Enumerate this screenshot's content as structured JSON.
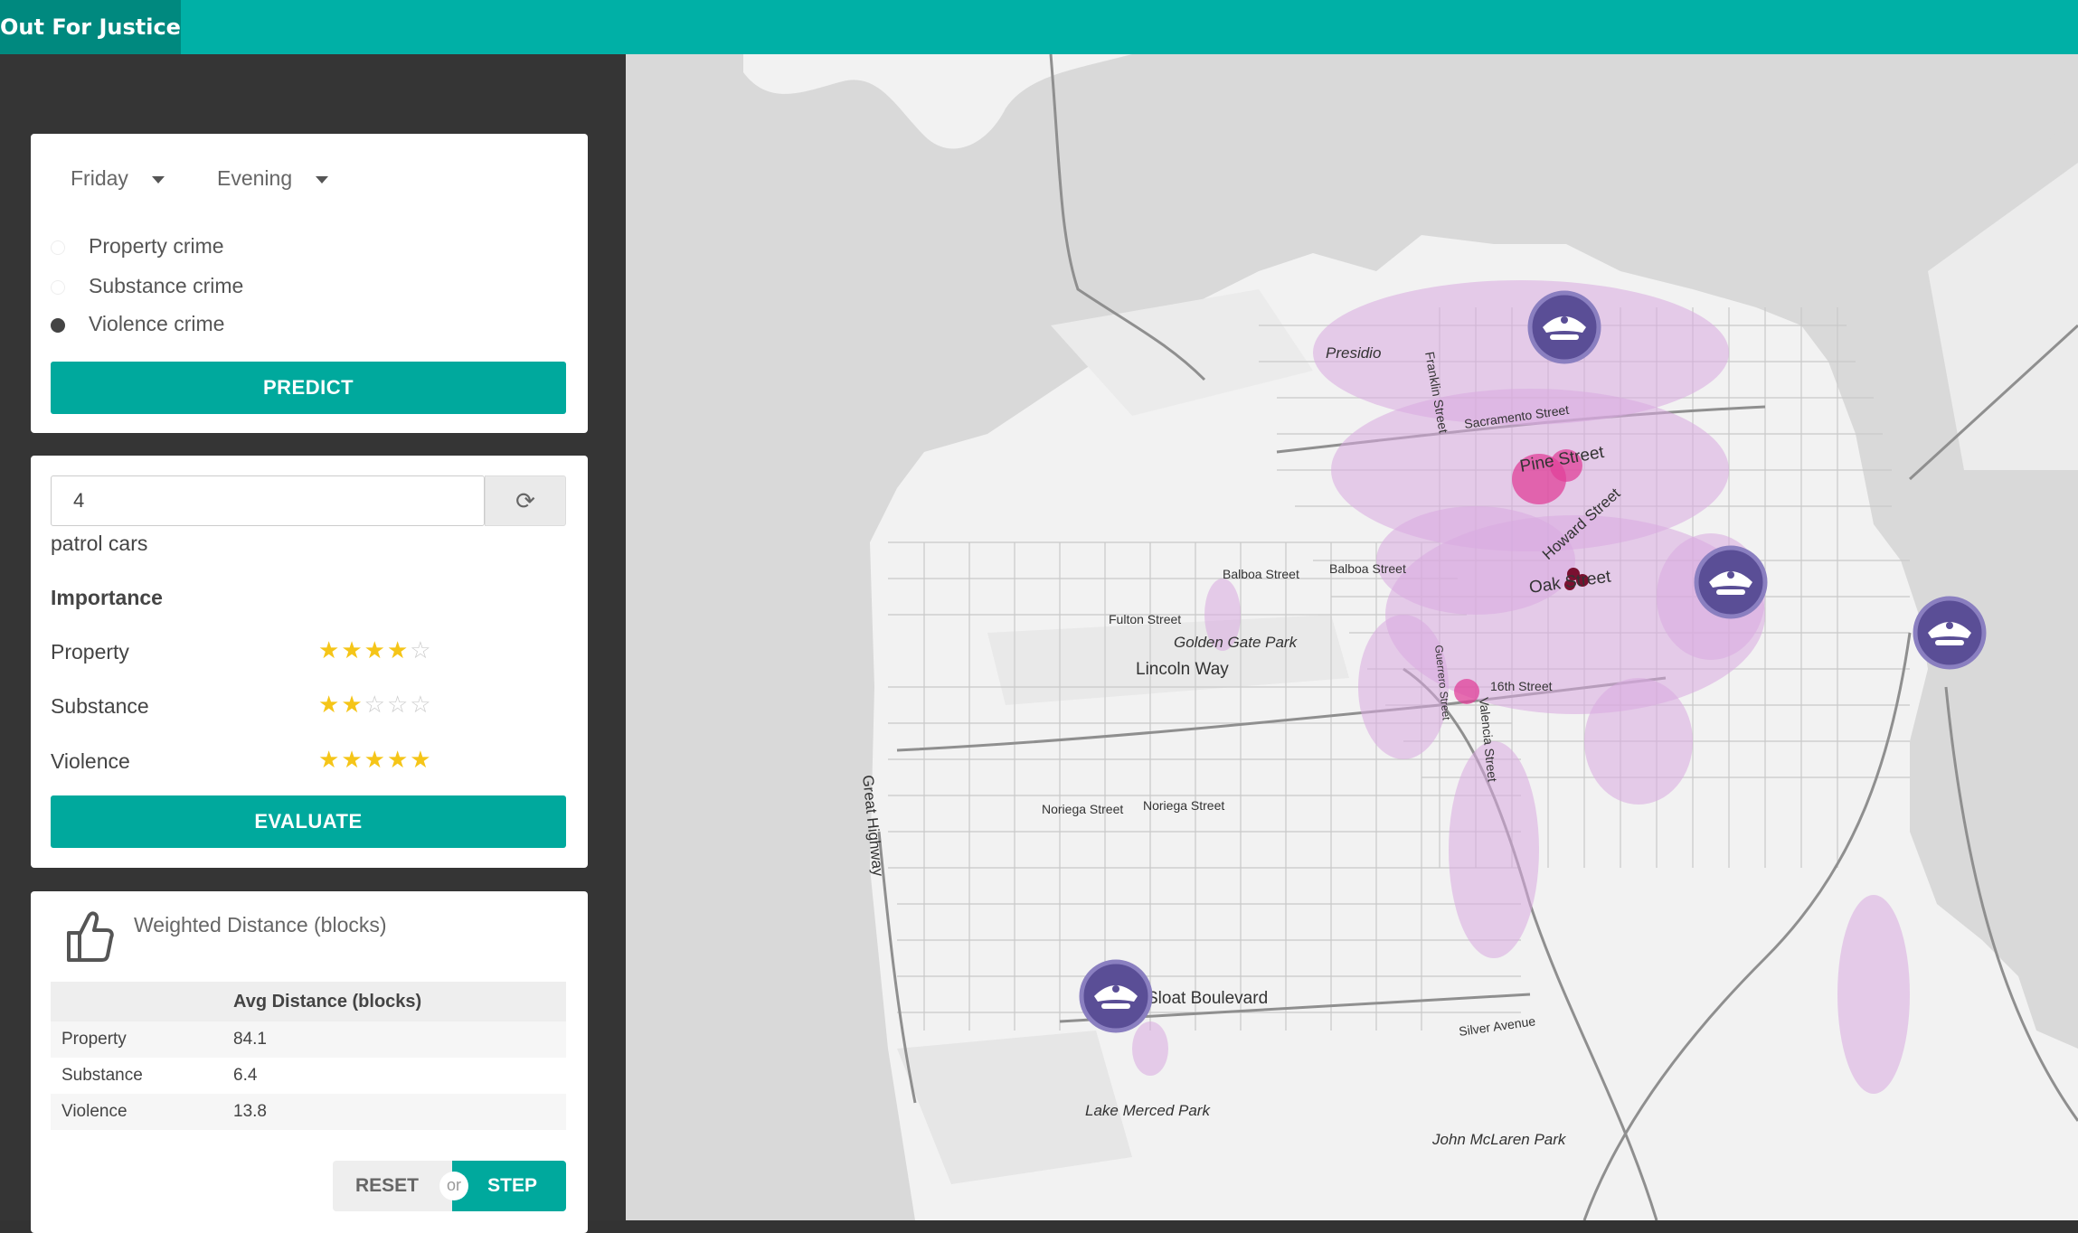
{
  "app": {
    "title": "Out For Justice"
  },
  "filters": {
    "day": "Friday",
    "time": "Evening",
    "crime_types": [
      {
        "label": "Property crime",
        "selected": false
      },
      {
        "label": "Substance crime",
        "selected": false
      },
      {
        "label": "Violence crime",
        "selected": true
      }
    ],
    "predict_label": "PREDICT"
  },
  "patrol": {
    "cars_value": "4",
    "cars_label": "patrol cars",
    "refresh_icon": "refresh-icon",
    "importance_title": "Importance",
    "importance": [
      {
        "label": "Property",
        "stars": 4,
        "max": 5
      },
      {
        "label": "Substance",
        "stars": 2,
        "max": 5
      },
      {
        "label": "Violence",
        "stars": 5,
        "max": 5
      }
    ],
    "evaluate_label": "EVALUATE"
  },
  "results": {
    "icon": "thumbs-up-icon",
    "title": "Weighted Distance (blocks)",
    "table_header": [
      "",
      "Avg Distance (blocks)"
    ],
    "rows": [
      {
        "type": "Property",
        "value": "84.1"
      },
      {
        "type": "Substance",
        "value": "6.4"
      },
      {
        "type": "Violence",
        "value": "13.8"
      }
    ],
    "reset_label": "RESET",
    "or_label": "or",
    "step_label": "STEP"
  },
  "map": {
    "street_labels": [
      "Presidio",
      "Franklin Street",
      "Sacramento Street",
      "Pine Street",
      "Howard Street",
      "Oak Street",
      "Balboa Street",
      "Balboa Street",
      "Fulton Street",
      "Golden Gate Park",
      "Lincoln Way",
      "Guerrero Street",
      "Valencia Street",
      "16th Street",
      "Great Highway",
      "Noriega Street",
      "Noriega Street",
      "Sloat Boulevard",
      "Silver Avenue",
      "Lake Merced Park",
      "John McLaren Park"
    ],
    "police_icon": "police-cap-icon",
    "colors": {
      "land": "#f2f2f2",
      "water": "#d9d9d9",
      "hotspot_light": "#d9a9e0",
      "hotspot_mid": "#e0409a",
      "hotspot_dark": "#7a1030",
      "marker": "#5a4e96"
    }
  }
}
